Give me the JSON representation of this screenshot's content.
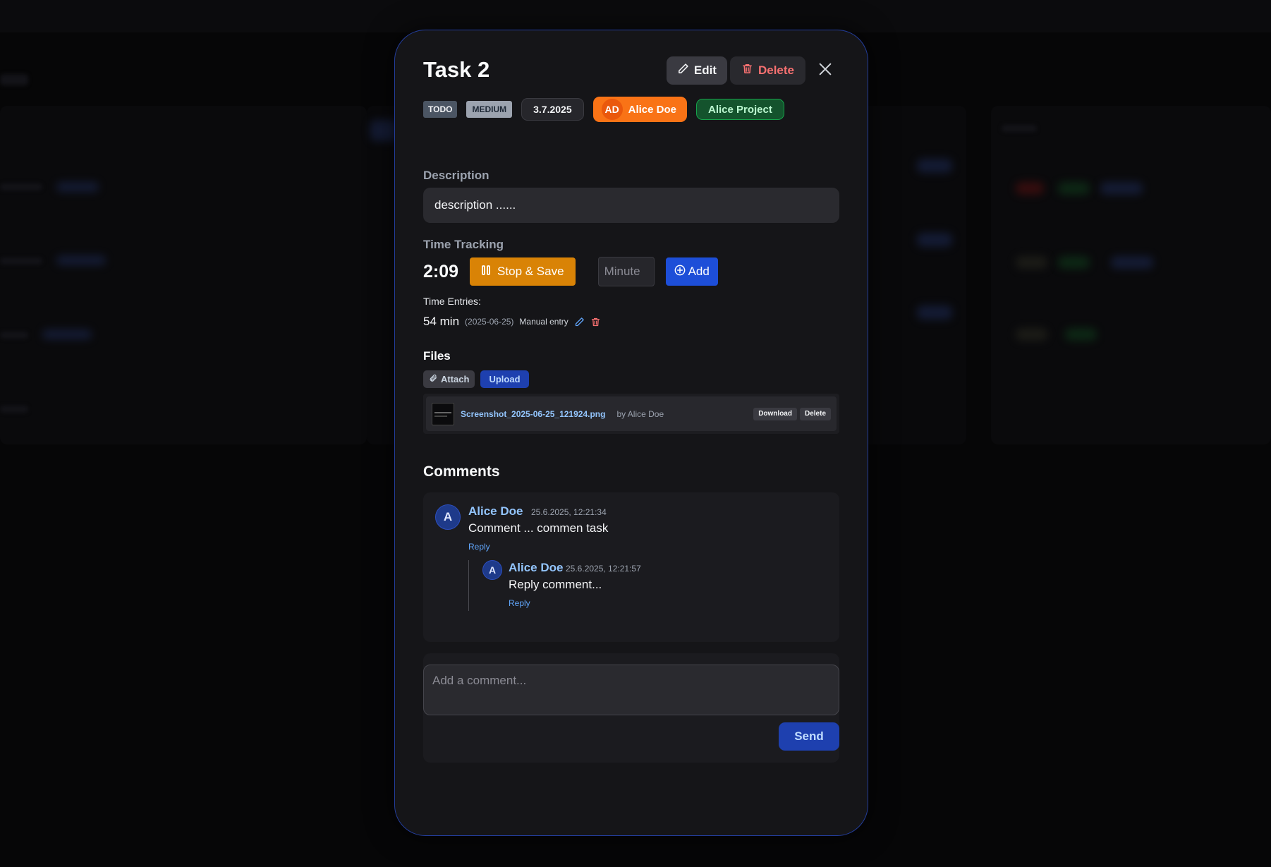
{
  "task": {
    "title": "Task 2",
    "edit_label": "Edit",
    "delete_label": "Delete"
  },
  "tags": {
    "status": "TODO",
    "priority": "MEDIUM",
    "date": "3.7.2025",
    "user_initials": "AD",
    "user_name": "Alice Doe",
    "project": "Alice Project"
  },
  "description": {
    "label": "Description",
    "text": "description ......"
  },
  "time_tracking": {
    "label": "Time Tracking",
    "timer": "2:09",
    "stop_label": "Stop & Save",
    "minute_placeholder": "Minute",
    "add_label": "Add",
    "entries_label": "Time Entries:",
    "entries": [
      {
        "amount": "54 min",
        "date": "(2025-06-25)",
        "note": "Manual entry"
      }
    ]
  },
  "files": {
    "label": "Files",
    "attach_label": "Attach",
    "upload_label": "Upload",
    "items": [
      {
        "name": "Screenshot_2025-06-25_121924.png",
        "by": "by Alice Doe",
        "download_label": "Download",
        "delete_label": "Delete"
      }
    ]
  },
  "comments": {
    "title": "Comments",
    "items": [
      {
        "avatar": "A",
        "author": "Alice Doe",
        "time": "25.6.2025, 12:21:34",
        "text": "Comment ... commen task",
        "reply_label": "Reply",
        "replies": [
          {
            "avatar": "A",
            "author": "Alice Doe",
            "time": "25.6.2025, 12:21:57",
            "text": "Reply comment...",
            "reply_label": "Reply"
          }
        ]
      }
    ],
    "input_placeholder": "Add a comment...",
    "send_label": "Send"
  },
  "colors": {
    "modal_border": "#233d9b",
    "accent_blue": "#1d4ed8",
    "warning_orange": "#d98306",
    "user_orange": "#f97316",
    "project_green": "#14532d",
    "danger_red": "#f87171"
  },
  "icons": [
    "pencil-icon",
    "trash-icon",
    "close-icon",
    "pause-icon",
    "plus-circle-icon",
    "paperclip-icon"
  ]
}
